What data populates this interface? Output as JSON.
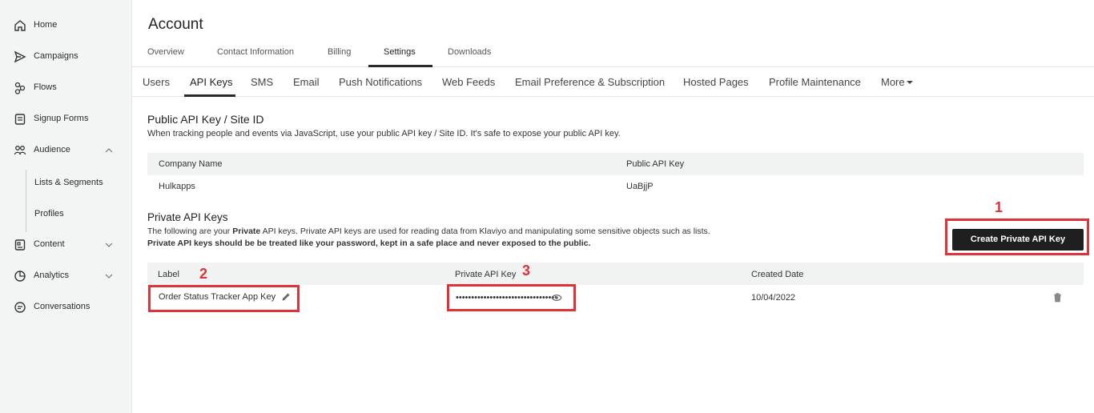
{
  "sidebar": {
    "items": [
      {
        "label": "Home",
        "icon": "home-icon"
      },
      {
        "label": "Campaigns",
        "icon": "send-icon"
      },
      {
        "label": "Flows",
        "icon": "flows-icon"
      },
      {
        "label": "Signup Forms",
        "icon": "form-icon"
      },
      {
        "label": "Audience",
        "icon": "audience-icon"
      },
      {
        "label": "Content",
        "icon": "content-icon"
      },
      {
        "label": "Analytics",
        "icon": "analytics-icon"
      },
      {
        "label": "Conversations",
        "icon": "chat-icon"
      }
    ],
    "audience_sub": [
      "Lists & Segments",
      "Profiles"
    ]
  },
  "header": {
    "title": "Account",
    "tabs": [
      "Overview",
      "Contact Information",
      "Billing",
      "Settings",
      "Downloads"
    ],
    "active_tab": "Settings"
  },
  "settings_tabs": {
    "items": [
      "Users",
      "API Keys",
      "SMS",
      "Email",
      "Push Notifications",
      "Web Feeds",
      "Email Preference & Subscription",
      "Hosted Pages",
      "Profile Maintenance",
      "More"
    ],
    "active": "API Keys"
  },
  "public_api": {
    "title": "Public API Key / Site ID",
    "description": "When tracking people and events via JavaScript, use your public API key / Site ID. It's safe to expose your public API key.",
    "col_company": "Company Name",
    "col_key": "Public API Key",
    "company": "Hulkapps",
    "key": "UaBjjP"
  },
  "private_api": {
    "title": "Private API Keys",
    "desc_1_pre": "The following are your ",
    "desc_1_bold": "Private",
    "desc_1_post": " API keys. Private API keys are used for reading data from Klaviyo and manipulating some sensitive objects such as lists.",
    "desc_2": "Private API keys should be be treated like your password, kept in a safe place and never exposed to the public.",
    "create_button": "Create Private API Key",
    "col_label": "Label",
    "col_key": "Private API Key",
    "col_date": "Created Date",
    "rows": [
      {
        "label": "Order Status Tracker App Key",
        "masked_key": "•••••••••••••••••••••••••••••••••",
        "created": "10/04/2022"
      }
    ]
  },
  "annotations": [
    "1",
    "2",
    "3"
  ],
  "colors": {
    "highlight": "#e03338",
    "button": "#1f1f1f",
    "sidebar": "#f3f4f4"
  }
}
